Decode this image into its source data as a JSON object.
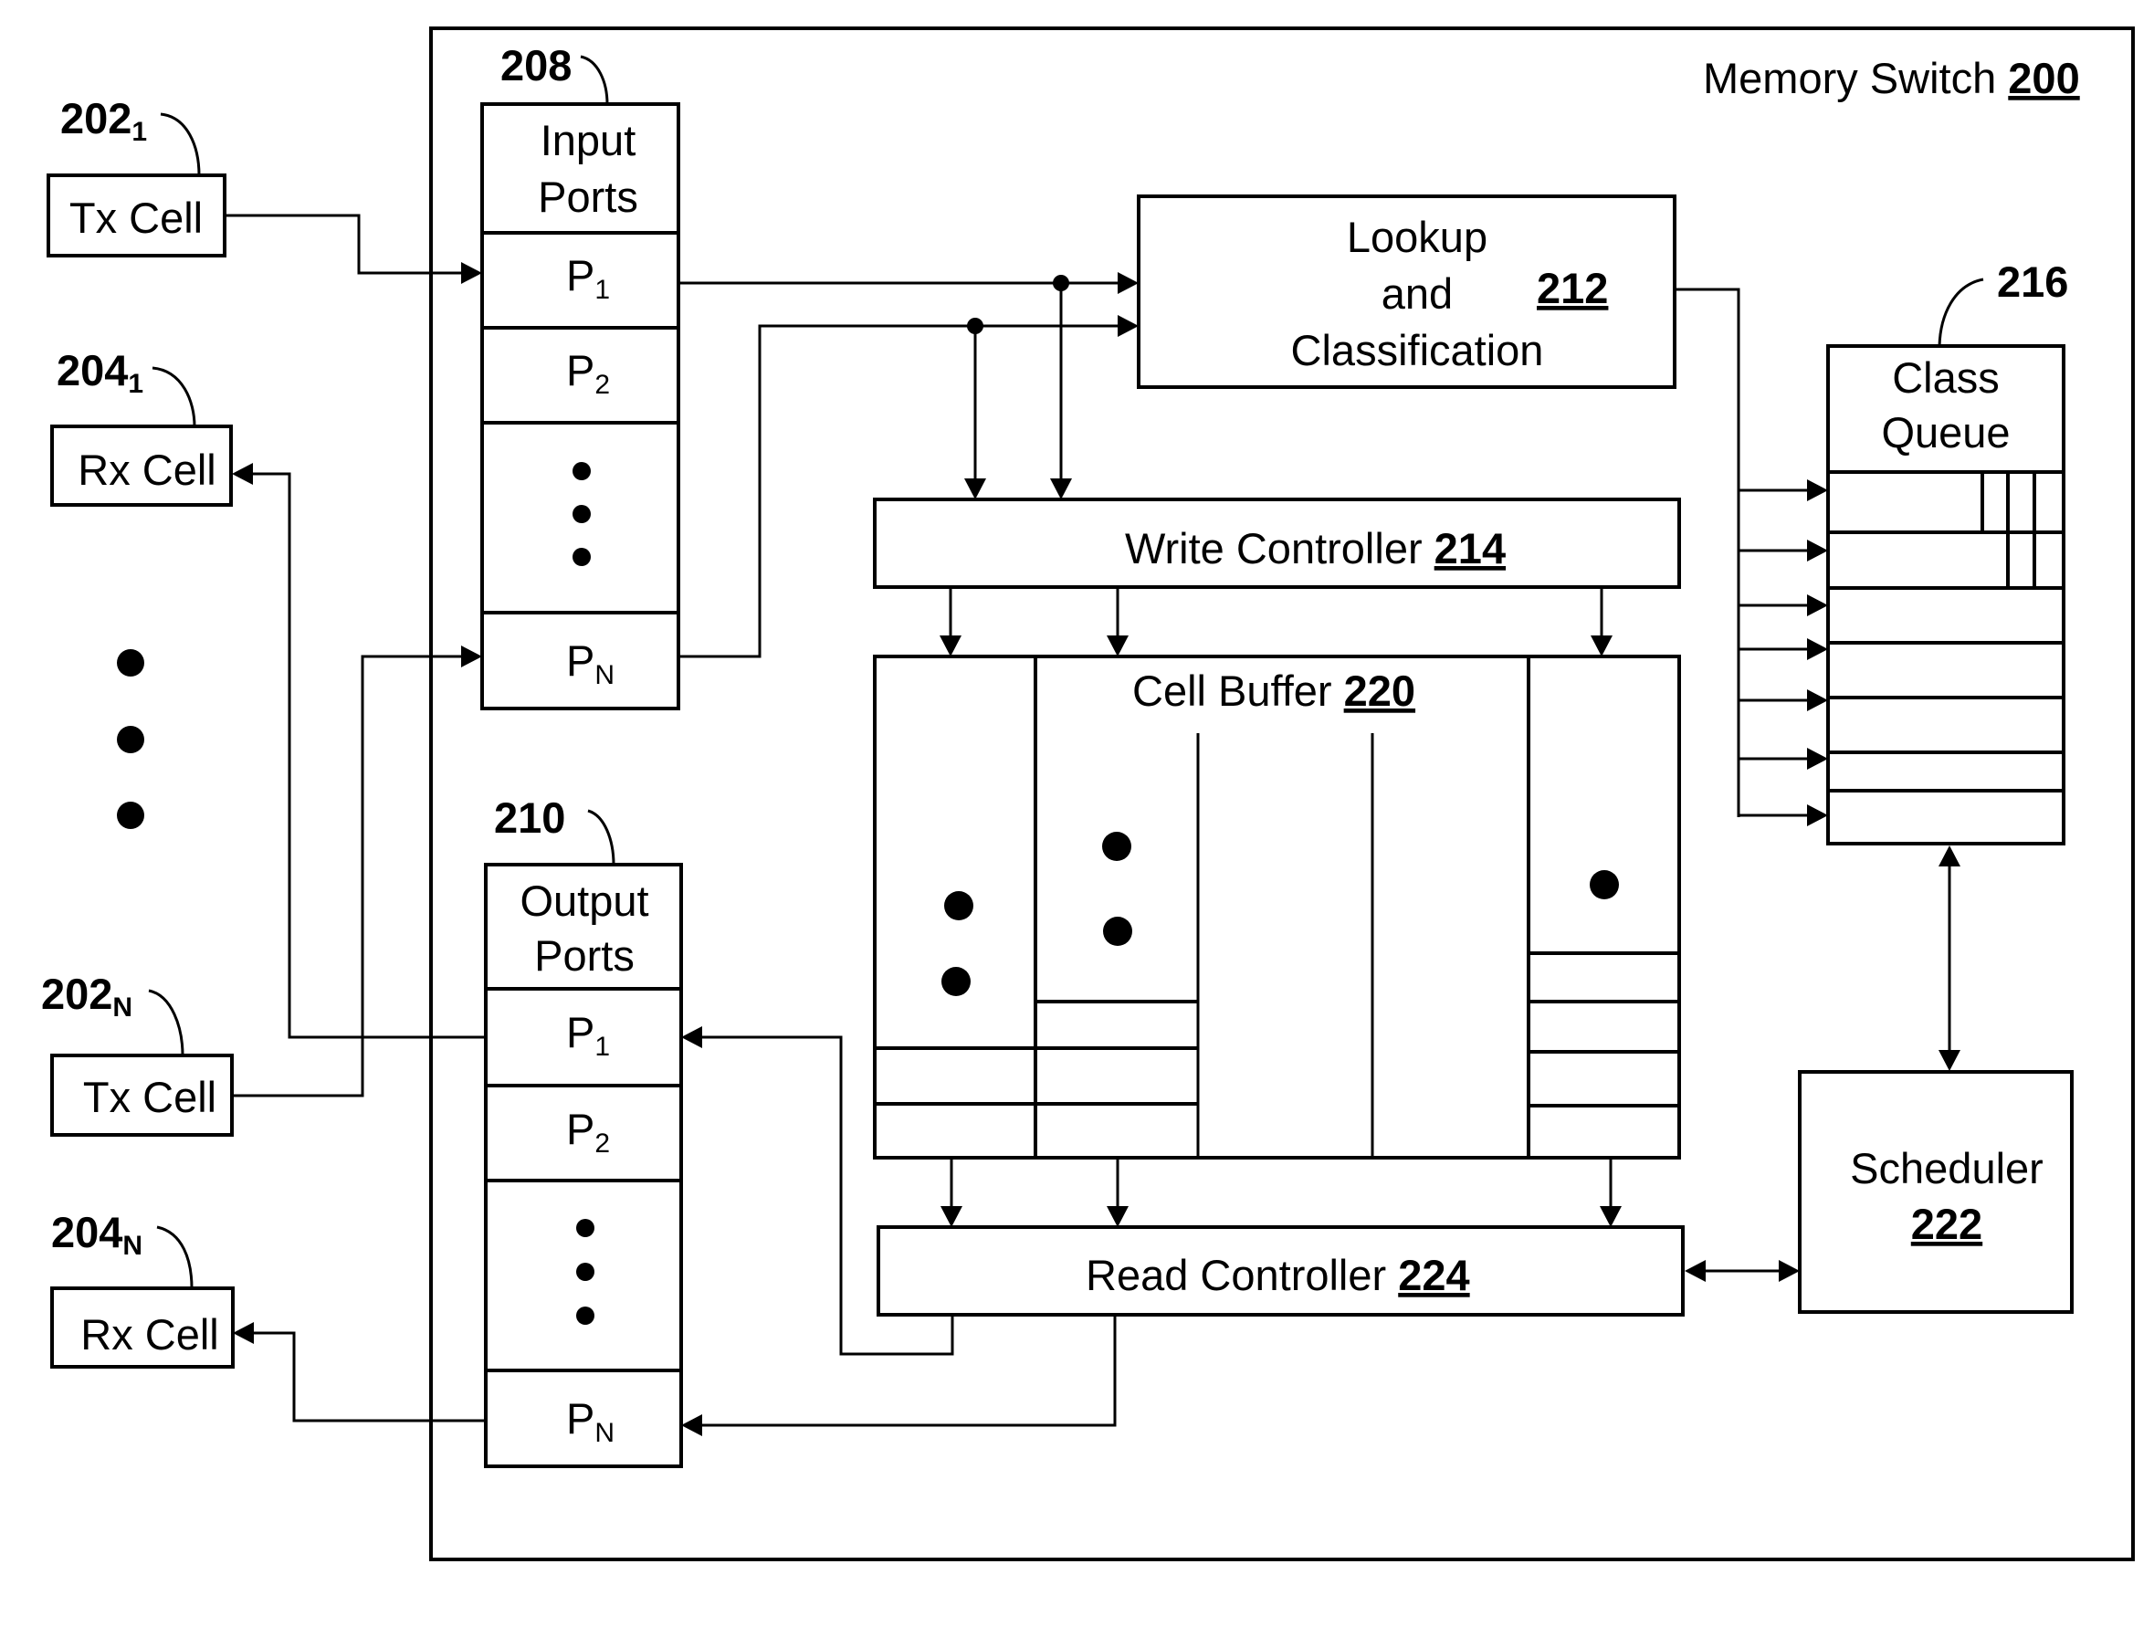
{
  "figure": {
    "title": "Memory Switch",
    "title_ref": "200"
  },
  "external": {
    "tx_cell_1": {
      "label": "Tx Cell",
      "ref": "202",
      "ref_sub": "1"
    },
    "rx_cell_1": {
      "label": "Rx Cell",
      "ref": "204",
      "ref_sub": "1"
    },
    "tx_cell_n": {
      "label": "Tx Cell",
      "ref": "202",
      "ref_sub": "N"
    },
    "rx_cell_n": {
      "label": "Rx Cell",
      "ref": "204",
      "ref_sub": "N"
    }
  },
  "input_ports": {
    "ref": "208",
    "title_line1": "Input",
    "title_line2": "Ports",
    "ports": [
      {
        "name": "P",
        "sub": "1"
      },
      {
        "name": "P",
        "sub": "2"
      },
      {
        "name": "P",
        "sub": "N"
      }
    ]
  },
  "output_ports": {
    "ref": "210",
    "title_line1": "Output",
    "title_line2": "Ports",
    "ports": [
      {
        "name": "P",
        "sub": "1"
      },
      {
        "name": "P",
        "sub": "2"
      },
      {
        "name": "P",
        "sub": "N"
      }
    ]
  },
  "lookup": {
    "line1": "Lookup",
    "line2": "and",
    "line3": "Classification",
    "ref": "212"
  },
  "write_controller": {
    "label": "Write Controller",
    "ref": "214"
  },
  "class_queue": {
    "ref": "216",
    "line1": "Class",
    "line2": "Queue"
  },
  "cell_buffer": {
    "label": "Cell Buffer",
    "ref": "220"
  },
  "scheduler": {
    "label": "Scheduler",
    "ref": "222"
  },
  "read_controller": {
    "label": "Read Controller",
    "ref": "224"
  }
}
